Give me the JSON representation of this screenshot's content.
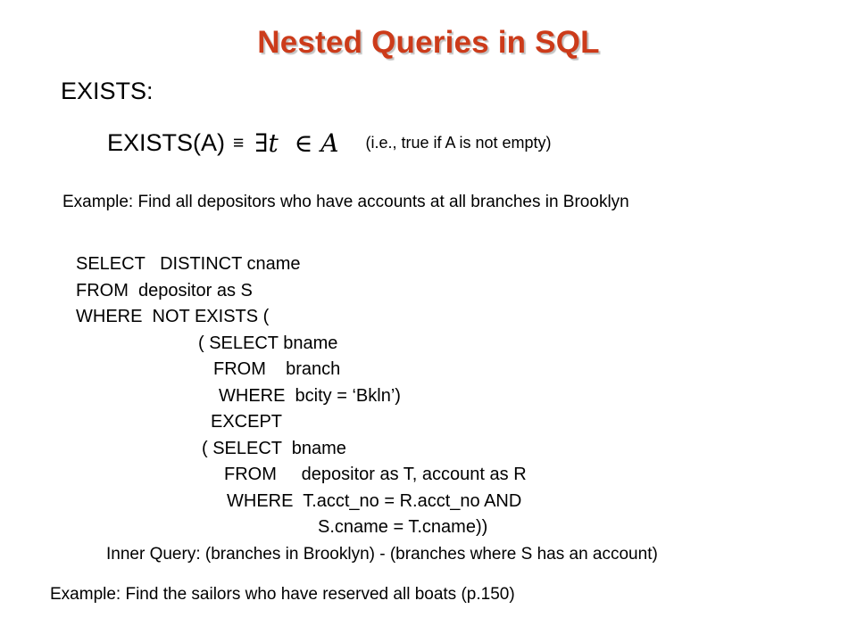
{
  "slide": {
    "title": "Nested Queries in SQL",
    "title_color": "#CC3B1A",
    "background_color": "#FFFFFF",
    "text_color": "#000000"
  },
  "section": {
    "heading": "EXISTS:"
  },
  "formula": {
    "lhs": "EXISTS(A)",
    "equivalence_symbol": "≡",
    "exists_symbol": "∃",
    "variable": "t",
    "member_symbol": "∈",
    "set": "A",
    "note": "(i.e., true if A is not empty)"
  },
  "example_top": {
    "text": "Example:  Find all depositors who have accounts at all branches in Brooklyn"
  },
  "sql": {
    "lines": [
      {
        "indent": 85,
        "text": "SELECT   DISTINCT cname"
      },
      {
        "indent": 85,
        "text": "FROM  depositor as S"
      },
      {
        "indent": 85,
        "text": "WHERE  NOT EXISTS ("
      },
      {
        "indent": 222,
        "text": "( SELECT bname"
      },
      {
        "indent": 239,
        "text": "FROM    branch"
      },
      {
        "indent": 245,
        "text": "WHERE  bcity = ‘Bkln’)"
      },
      {
        "indent": 236,
        "text": "EXCEPT"
      },
      {
        "indent": 226,
        "text": "( SELECT  bname"
      },
      {
        "indent": 251,
        "text": "FROM     depositor as T, account as R"
      },
      {
        "indent": 254,
        "text": "WHERE  T.acct_no = R.acct_no AND"
      },
      {
        "indent": 356,
        "text": "S.cname = T.cname))"
      }
    ]
  },
  "inner_query": {
    "text": "Inner Query:  (branches in Brooklyn) - (branches where S has an account)"
  },
  "example_bottom": {
    "text": "Example: Find the sailors who have reserved all boats   (p.150)"
  }
}
